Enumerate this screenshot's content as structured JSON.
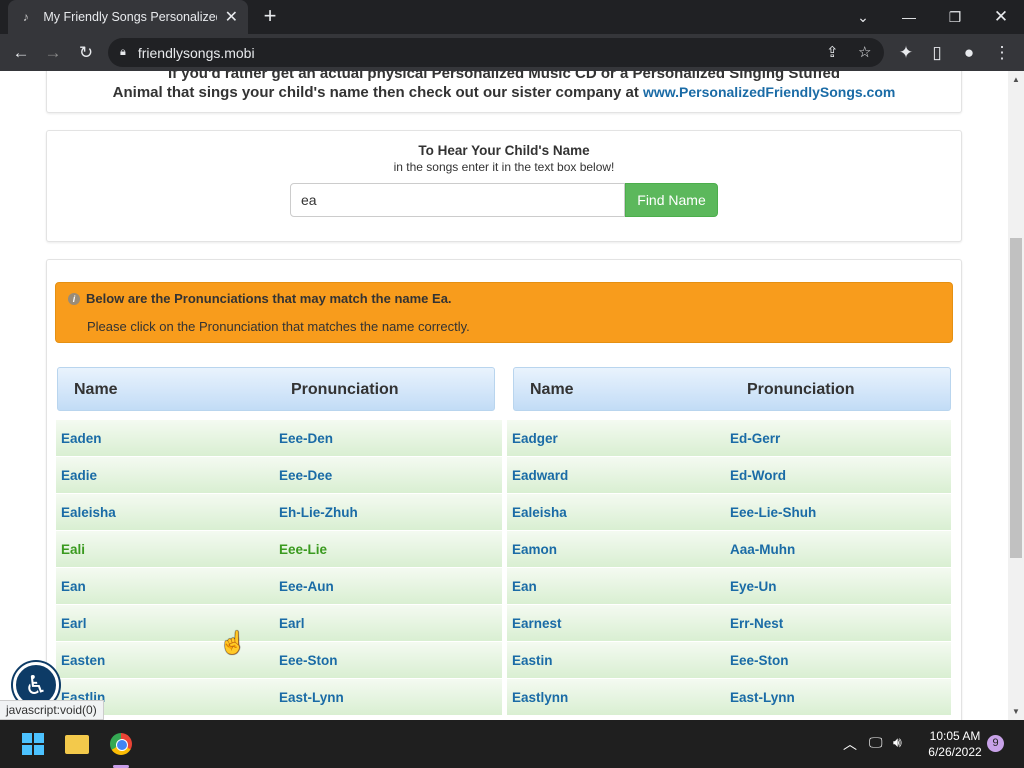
{
  "browser": {
    "tab_title": "My Friendly Songs Personalized M",
    "url": "friendlysongs.mobi"
  },
  "sister": {
    "line1": "If you'd rather get an actual physical Personalized Music CD or a Personalized Singing Stuffed",
    "line2": "Animal that sings your child's name then check out our sister company at",
    "link": "www.PersonalizedFriendlySongs.com"
  },
  "search": {
    "heading": "To Hear Your Child's Name",
    "subheading": "in the songs enter it in the text box below!",
    "input_value": "ea",
    "button_label": "Find Name"
  },
  "alert": {
    "title": "Below are the Pronunciations that may match the name Ea.",
    "message": "Please click on the Pronunciation that matches the name correctly."
  },
  "table": {
    "col_name": "Name",
    "col_pron": "Pronunciation",
    "left": [
      {
        "name": "Eaden",
        "pron": "Eee-Den"
      },
      {
        "name": "Eadie",
        "pron": "Eee-Dee"
      },
      {
        "name": "Ealeisha",
        "pron": "Eh-Lie-Zhuh"
      },
      {
        "name": "Eali",
        "pron": "Eee-Lie"
      },
      {
        "name": "Ean",
        "pron": "Eee-Aun"
      },
      {
        "name": "Earl",
        "pron": "Earl"
      },
      {
        "name": "Easten",
        "pron": "Eee-Ston"
      },
      {
        "name": "Eastlin",
        "pron": "East-Lynn"
      }
    ],
    "right": [
      {
        "name": "Eadger",
        "pron": "Ed-Gerr"
      },
      {
        "name": "Eadward",
        "pron": "Ed-Word"
      },
      {
        "name": "Ealeisha",
        "pron": "Eee-Lie-Shuh"
      },
      {
        "name": "Eamon",
        "pron": "Aaa-Muhn"
      },
      {
        "name": "Ean",
        "pron": "Eye-Un"
      },
      {
        "name": "Earnest",
        "pron": "Err-Nest"
      },
      {
        "name": "Eastin",
        "pron": "Eee-Ston"
      },
      {
        "name": "Eastlynn",
        "pron": "East-Lynn"
      }
    ],
    "hovered_index": 3
  },
  "status_text": "javascript:void(0)",
  "taskbar": {
    "time": "10:05 AM",
    "date": "6/26/2022",
    "notifications": "9"
  }
}
